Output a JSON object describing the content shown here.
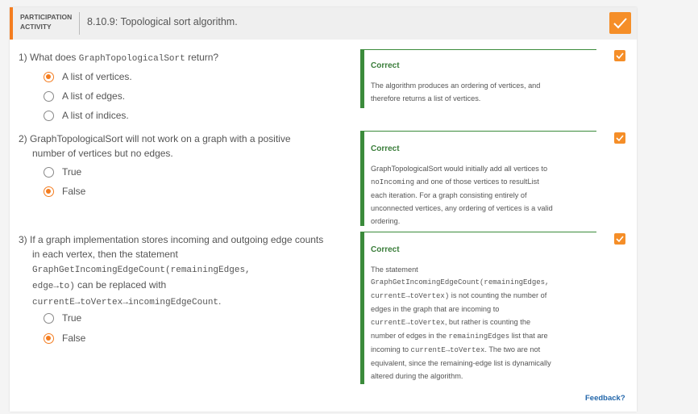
{
  "header": {
    "label_line1": "PARTICIPATION",
    "label_line2": "ACTIVITY",
    "title": "8.10.9: Topological sort algorithm."
  },
  "questions": [
    {
      "number": "1)",
      "text_parts": [
        "What does ",
        "GraphTopologicalSort",
        " return?"
      ],
      "options": [
        {
          "label": "A list of vertices.",
          "selected": true
        },
        {
          "label": "A list of edges.",
          "selected": false
        },
        {
          "label": "A list of indices.",
          "selected": false
        }
      ],
      "feedback_title": "Correct",
      "feedback_lines": [
        "The algorithm produces an ordering of vertices, and",
        "therefore returns a list of vertices."
      ]
    },
    {
      "number": "2)",
      "line1": "GraphTopologicalSort will not work on a graph with a positive",
      "line2": "number of vertices but no edges.",
      "options": [
        {
          "label": "True",
          "selected": false
        },
        {
          "label": "False",
          "selected": true
        }
      ],
      "feedback_title": "Correct",
      "feedback_l1": "GraphTopologicalSort would initially add all vertices to",
      "feedback_l2_code": "noIncoming",
      "feedback_l2_text": " and one of those vertices to resultList",
      "feedback_l3": "each iteration. For a graph consisting entirely of",
      "feedback_l4": "unconnected vertices, any ordering of vertices is a valid",
      "feedback_l5": "ordering."
    },
    {
      "number": "3)",
      "line1": "If a graph implementation stores incoming and outgoing edge counts",
      "line2": "in each vertex, then the statement",
      "line3_code": "GraphGetIncomingEdgeCount(remainingEdges,",
      "line4_code": "edge→to)",
      "line4_text": " can be replaced with",
      "line5_code": "currentE→toVertex→incomingEdgeCount",
      "line5_text": ".",
      "options": [
        {
          "label": "True",
          "selected": false
        },
        {
          "label": "False",
          "selected": true
        }
      ],
      "feedback_title": "Correct",
      "fb_l1": "The statement",
      "fb_l2_code": "GraphGetIncomingEdgeCount(remainingEdges,",
      "fb_l3_code": "currentE→toVertex)",
      "fb_l3_text": " is not counting the number of",
      "fb_l4": "edges in the graph that are incoming to",
      "fb_l5_code": "currentE→toVertex",
      "fb_l5_text": ", but rather is counting the",
      "fb_l6_text": "number of edges in the ",
      "fb_l6_code": "remainingEdges",
      "fb_l6_text2": " list that are",
      "fb_l7_text": "incoming to ",
      "fb_l7_code": "currentE→toVertex",
      "fb_l7_text2": ". The two are not",
      "fb_l8": "equivalent, since the remaining-edge list is dynamically",
      "fb_l9": "altered during the algorithm."
    }
  ],
  "feedback_link": "Feedback?",
  "colors": {
    "accent": "#f47d20",
    "correct": "#3b8b3b",
    "link": "#2266aa"
  },
  "icons": {
    "check": "checkmark-icon"
  }
}
